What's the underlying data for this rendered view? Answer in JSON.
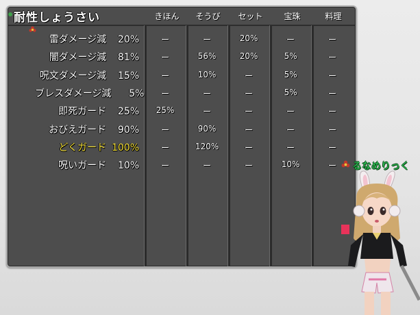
{
  "title": "耐性しょうさい",
  "columns": [
    "きほん",
    "そうび",
    "セット",
    "宝珠",
    "料理"
  ],
  "rows": [
    {
      "label": "雷ダメージ減",
      "total": "20%",
      "cells": [
        "ー",
        "ー",
        "20%",
        "ー",
        "ー"
      ],
      "highlight": false
    },
    {
      "label": "闇ダメージ減",
      "total": "81%",
      "cells": [
        "ー",
        "56%",
        "20%",
        "5%",
        "ー"
      ],
      "highlight": false
    },
    {
      "label": "呪文ダメージ減",
      "total": "15%",
      "cells": [
        "ー",
        "10%",
        "ー",
        "5%",
        "ー"
      ],
      "highlight": false
    },
    {
      "label": "ブレスダメージ減",
      "total": "5%",
      "cells": [
        "ー",
        "ー",
        "ー",
        "5%",
        "ー"
      ],
      "highlight": false
    },
    {
      "label": "即死ガード",
      "total": "25%",
      "cells": [
        "25%",
        "ー",
        "ー",
        "ー",
        "ー"
      ],
      "highlight": false
    },
    {
      "label": "おびえガード",
      "total": "90%",
      "cells": [
        "ー",
        "90%",
        "ー",
        "ー",
        "ー"
      ],
      "highlight": false
    },
    {
      "label": "どくガード",
      "total": "100%",
      "cells": [
        "ー",
        "120%",
        "ー",
        "ー",
        "ー"
      ],
      "highlight": true
    },
    {
      "label": "呪いガード",
      "total": "10%",
      "cells": [
        "ー",
        "ー",
        "ー",
        "10%",
        "ー"
      ],
      "highlight": false
    }
  ],
  "player": {
    "name": "るなめりっく"
  },
  "colors": {
    "panel": "#4d4d4d",
    "highlight": "#f7e23a",
    "player_name": "#2fd05a"
  }
}
